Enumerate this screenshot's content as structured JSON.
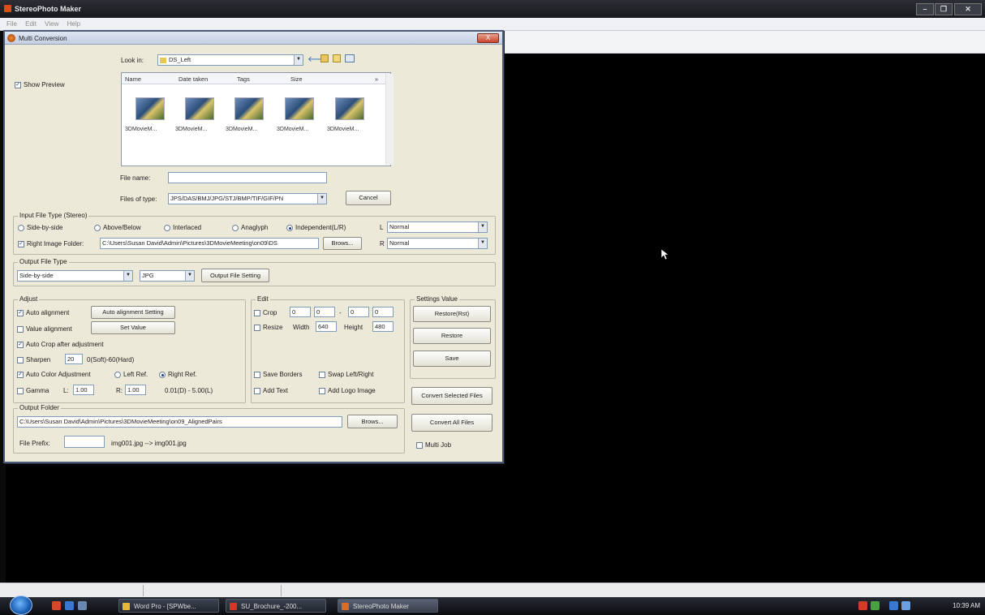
{
  "app": {
    "title": "StereoPhoto Maker",
    "menu": [
      "File",
      "Edit",
      "View",
      "Help"
    ]
  },
  "dialog": {
    "title": "Multi Conversion",
    "close": "X",
    "look_in_label": "Look in:",
    "look_in_value": "DS_Left",
    "show_preview": "Show Preview",
    "columns": [
      "Name",
      "Date taken",
      "Tags",
      "Size"
    ],
    "files": [
      "3DMovieM...",
      "3DMovieM...",
      "3DMovieM...",
      "3DMovieM...",
      "3DMovieM..."
    ],
    "file_name_label": "File name:",
    "file_name_value": "",
    "files_of_type_label": "Files of type:",
    "files_of_type_value": "JPS/DAS/BMJ/JPG/STJ/BMP/TIF/GIF/PN",
    "cancel": "Cancel",
    "input_group": "Input File Type (Stereo)",
    "input_options": [
      "Side-by-side",
      "Above/Below",
      "Interlaced",
      "Anaglyph",
      "Independent(L/R)"
    ],
    "left_label": "L",
    "left_value": "Normal",
    "right_label": "R",
    "right_value": "Normal",
    "right_folder_label": "Right Image Folder:",
    "right_folder_value": "C:\\Users\\Susan David\\Admin\\Pictures\\3DMovieMeeting\\on09\\DS",
    "browse_short": "Brows...",
    "output_group": "Output File Type",
    "output_type": "Side-by-side",
    "output_format": "JPG",
    "output_setting": "Output File Setting",
    "adjust_group": "Adjust",
    "auto_alignment": "Auto alignment",
    "auto_alignment_setting": "Auto alignment Setting",
    "value_alignment": "Value alignment",
    "set_value": "Set Value",
    "auto_crop": "Auto Crop after adjustment",
    "sharpen": "Sharpen",
    "sharpen_value": "20",
    "sharpen_range": "0(Soft)-60(Hard)",
    "auto_color": "Auto Color Adjustment",
    "left_ref": "Left Ref.",
    "right_ref": "Right Ref.",
    "gamma": "Gamma",
    "gamma_l_label": "L:",
    "gamma_l": "1.00",
    "gamma_r_label": "R:",
    "gamma_r": "1.00",
    "gamma_range": "0.01(D) - 5.00(L)",
    "edit_group": "Edit",
    "crop": "Crop",
    "crop_values": [
      "0",
      "0",
      "0",
      "0"
    ],
    "crop_dash": "-",
    "resize": "Resize",
    "width_label": "Width",
    "width_value": "640",
    "height_label": "Height",
    "height_value": "480",
    "save_borders": "Save Borders",
    "swap": "Swap Left/Right",
    "add_text": "Add Text",
    "add_logo": "Add Logo Image",
    "settings_group": "Settings Value",
    "restore_rst": "Restore(Rst)",
    "restore": "Restore",
    "save": "Save",
    "convert_selected": "Convert Selected Files",
    "convert_all": "Convert All Files",
    "multi_job": "Multi Job",
    "output_folder_group": "Output Folder",
    "output_folder_value": "C:\\Users\\Susan David\\Admin\\Pictures\\3DMovieMeeting\\on09_AlignedPairs",
    "browse": "Brows...",
    "file_prefix_label": "File Prefix:",
    "file_prefix_value": "",
    "prefix_example": "img001.jpg --> img001.jpg"
  },
  "taskbar": {
    "items": [
      "Word Pro - [SPWbe...",
      "SU_Brochure_-200...",
      "StereoPhoto Maker"
    ],
    "clock": "10:39 AM"
  },
  "colors": {
    "dialog_bg": "#ece9d8",
    "canvas": "#000000",
    "taskbar": "#1b1e25"
  }
}
